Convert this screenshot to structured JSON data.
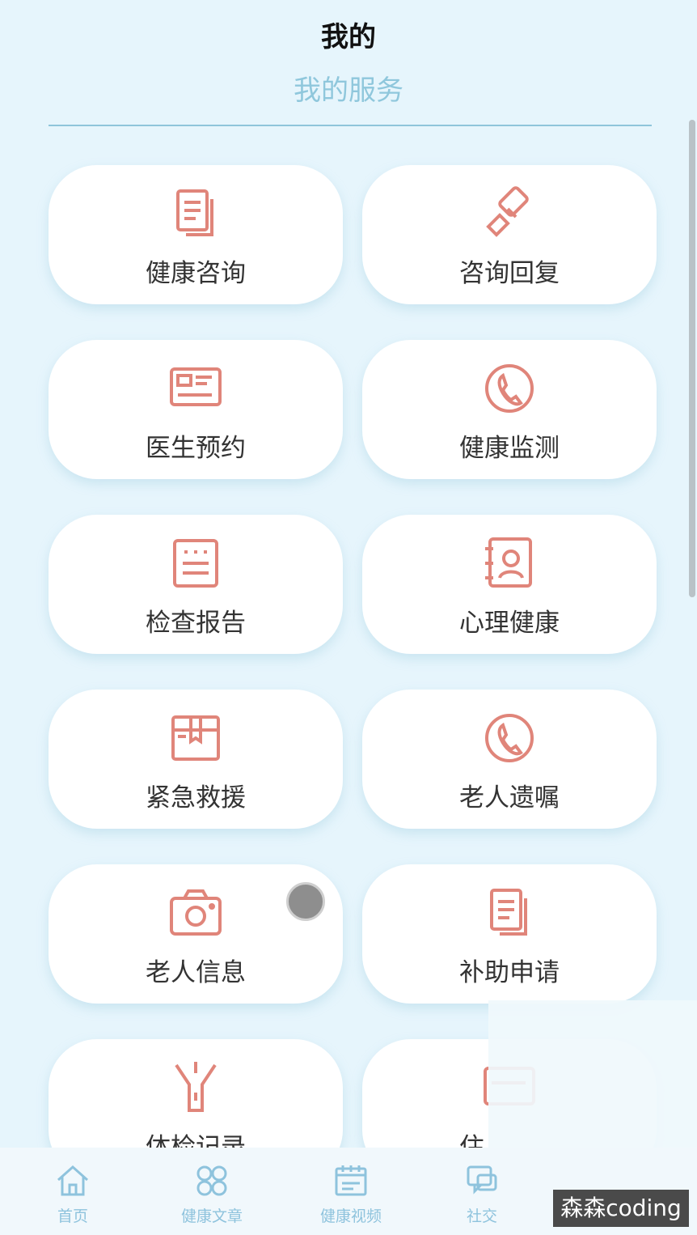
{
  "header": {
    "title": "我的",
    "subtitle": "我的服务"
  },
  "services": [
    {
      "label": "健康咨询",
      "icon": "document-icon"
    },
    {
      "label": "咨询回复",
      "icon": "stamp-icon"
    },
    {
      "label": "医生预约",
      "icon": "id-card-icon"
    },
    {
      "label": "健康监测",
      "icon": "phone-icon"
    },
    {
      "label": "检查报告",
      "icon": "report-icon"
    },
    {
      "label": "心理健康",
      "icon": "contact-book-icon"
    },
    {
      "label": "紧急救援",
      "icon": "box-icon"
    },
    {
      "label": "老人遗嘱",
      "icon": "phone-icon"
    },
    {
      "label": "老人信息",
      "icon": "camera-icon"
    },
    {
      "label": "补助申请",
      "icon": "document-icon"
    },
    {
      "label": "体检记录",
      "icon": "flashlight-icon"
    },
    {
      "label": "住",
      "icon": "id-card-icon"
    }
  ],
  "tabbar": {
    "items": [
      {
        "label": "首页",
        "icon": "home-icon"
      },
      {
        "label": "健康文章",
        "icon": "grid-icon"
      },
      {
        "label": "健康视频",
        "icon": "calendar-icon"
      },
      {
        "label": "社交",
        "icon": "chat-icon"
      }
    ]
  },
  "watermark": "森森coding",
  "colors": {
    "accent": "#e0857a",
    "background": "#e6f5fc",
    "subtitle": "#8fc7dc",
    "tab": "#8ec3dd"
  }
}
